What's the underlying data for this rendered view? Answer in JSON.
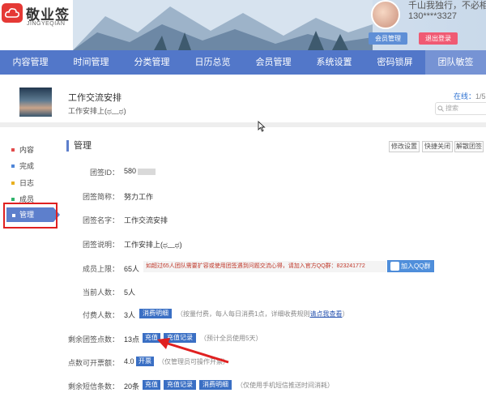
{
  "brand": {
    "name": "敬业签",
    "sub": "JINGYEQIAN"
  },
  "user": {
    "motto": "千山我独行，不必相送",
    "phone": "130****3327",
    "member_btn": "会员管理",
    "logout_btn": "退出登录"
  },
  "nav": [
    {
      "label": "内容管理"
    },
    {
      "label": "时间管理"
    },
    {
      "label": "分类管理"
    },
    {
      "label": "日历总览"
    },
    {
      "label": "会员管理"
    },
    {
      "label": "系统设置"
    },
    {
      "label": "密码锁屏"
    },
    {
      "label": "团队敏签"
    }
  ],
  "group": {
    "name": "工作交流安排",
    "desc": "工作安排上(ಥ﹏ಥ)",
    "online_label": "在线：",
    "online_count": "1/5",
    "search_placeholder": "搜索"
  },
  "sidebar": [
    {
      "label": "内容"
    },
    {
      "label": "完成"
    },
    {
      "label": "日志"
    },
    {
      "label": "成员"
    },
    {
      "label": "管理"
    }
  ],
  "colors": {
    "nav": "#5277c9",
    "accent": "#5d7fcc",
    "button": "#3a6fc4",
    "warn": "#c0392b",
    "highlight": "#e02020"
  },
  "main": {
    "title": "管理",
    "actions": [
      "修改设置",
      "快捷关闭",
      "解散团签"
    ],
    "rows": {
      "id": {
        "label": "团签ID：",
        "value": "580"
      },
      "short": {
        "label": "团签简称：",
        "value": "努力工作"
      },
      "name": {
        "label": "团签名字：",
        "value": "工作交流安排"
      },
      "desc": {
        "label": "团签说明：",
        "value": "工作安排上(ಥ﹏ಥ)"
      },
      "limit": {
        "label": "成员上限：",
        "value": "65人",
        "warn": "如超过65人团队需要扩容或使用团签遇到问题交流心得，请加入官方QQ群：823241772",
        "qq_btn": "加入QQ群"
      },
      "current": {
        "label": "当前人数：",
        "value": "5人"
      },
      "paid": {
        "label": "付费人数：",
        "value": "3人",
        "btn": "消费明细",
        "note": "（按量付费，每人每日消费1点，详细收费规则",
        "link": "请点我查看",
        "note_end": "）"
      },
      "points": {
        "label": "剩余团签点数：",
        "value": "13点",
        "btn1": "充值",
        "btn2": "充值记录",
        "note": "（预计全员使用5天）"
      },
      "invoice": {
        "label": "点数可开票额：",
        "value": "4.0",
        "btn": "开票",
        "note": "（仅管理员可操作开票）"
      },
      "sms": {
        "label": "剩余短信条数：",
        "value": "20条",
        "btn1": "充值",
        "btn2": "充值记录",
        "btn3": "消费明细",
        "note": "（仅使用手机短信推送时间消耗）"
      }
    }
  }
}
